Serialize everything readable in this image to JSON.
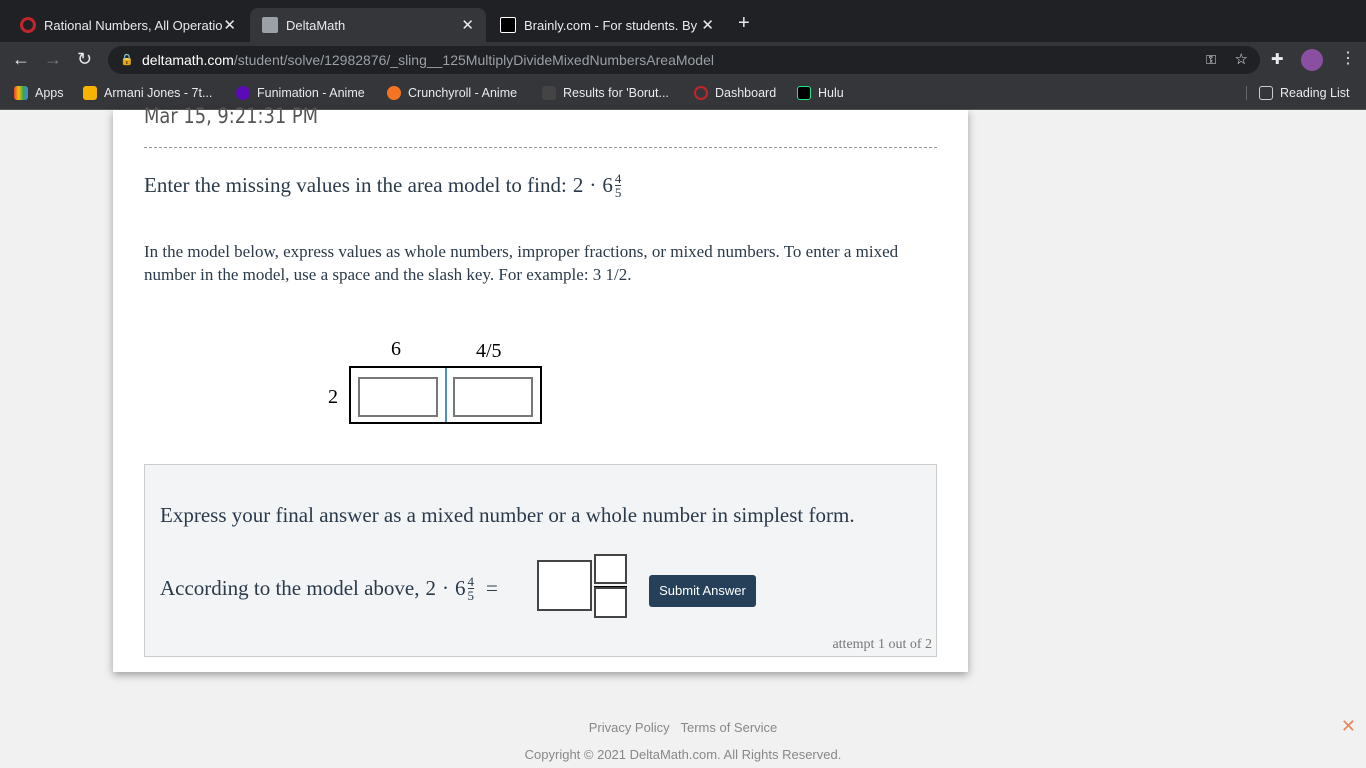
{
  "browser": {
    "tabs": [
      {
        "title": "Rational Numbers, All Operatio",
        "active": false
      },
      {
        "title": "DeltaMath",
        "active": true
      },
      {
        "title": "Brainly.com - For students. By",
        "active": false
      }
    ],
    "url_host": "deltamath.com",
    "url_path": "/student/solve/12982876/_sling__125MultiplyDivideMixedNumbersAreaModel",
    "bookmarks": [
      "Apps",
      "Armani Jones - 7t...",
      "Funimation - Anime",
      "Crunchyroll - Anime",
      "Results for 'Borut...",
      "Dashboard",
      "Hulu"
    ],
    "reading_list": "Reading List"
  },
  "problem": {
    "timestamp": "Mar 15, 9:21:31 PM",
    "prompt": "Enter the missing values in the area model to find:",
    "expr_whole_factor": "2",
    "expr_mixed_whole": "6",
    "expr_num": "4",
    "expr_den": "5",
    "instructions": "In the model below, express values as whole numbers, improper fractions, or mixed numbers. To enter a mixed number in the model, use a space and the slash key. For example: 3 1/2.",
    "model": {
      "col1": "6",
      "col2": "4/5",
      "row": "2"
    },
    "final_instruction": "Express your final answer as a mixed number or a whole number in simplest form.",
    "answer_prefix": "According to the model above,",
    "submit": "Submit Answer",
    "attempt": "attempt 1 out of 2"
  },
  "footer": {
    "privacy": "Privacy Policy",
    "terms": "Terms of Service",
    "copyright": "Copyright © 2021 DeltaMath.com. All Rights Reserved."
  }
}
